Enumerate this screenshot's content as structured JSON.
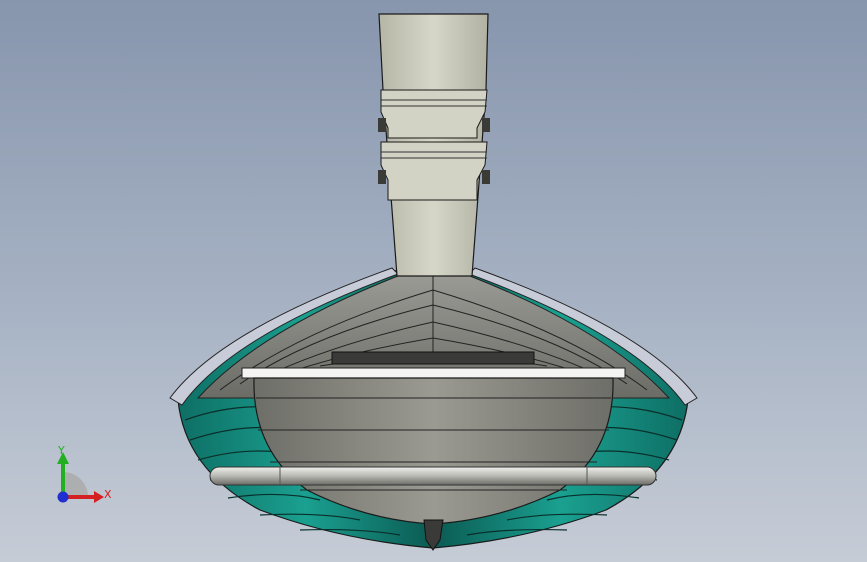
{
  "viewport": {
    "background_top": "#8795ad",
    "background_bottom": "#c6ccd6"
  },
  "model": {
    "hull_color": "#1a9a8a",
    "hull_dark": "#0f6e63",
    "wood_color": "#8a8a82",
    "column_color": "#c9cabb",
    "rail_color": "#d0d0cc"
  },
  "triad": {
    "x_label": "X",
    "y_label": "Y",
    "x_color": "#d42020",
    "y_color": "#22b022",
    "z_color": "#2030d0"
  }
}
